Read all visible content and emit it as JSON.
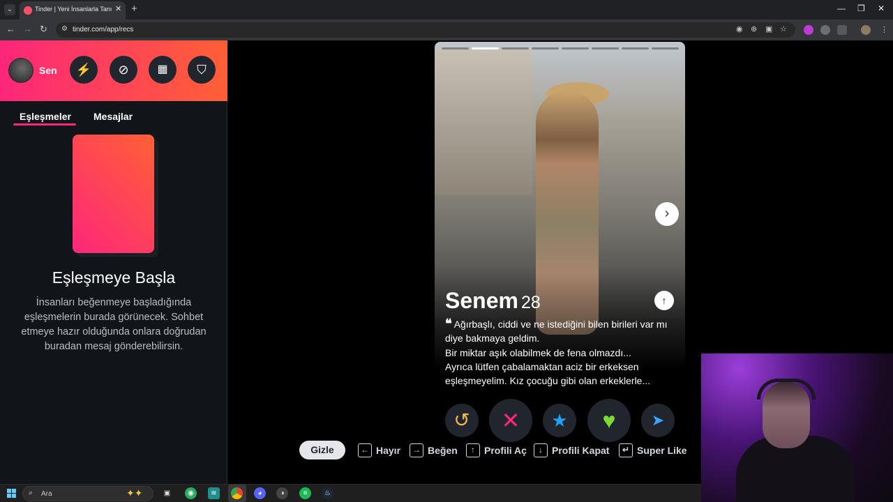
{
  "browser": {
    "tab_title": "Tinder | Yeni İnsanlarla Tanış, Bu",
    "close_glyph": "✕",
    "new_tab_glyph": "+",
    "url": "tinder.com/app/recs",
    "back": "←",
    "forward": "→",
    "reload": "↻"
  },
  "sidebar": {
    "user_name": "Sen",
    "tabs": [
      {
        "label": "Eşleşmeler"
      },
      {
        "label": "Mesajlar"
      }
    ],
    "empty_title": "Eşleşmeye Başla",
    "empty_text": "İnsanları beğenmeye başladığında eşleşmelerin burada görünecek. Sohbet etmeye hazır olduğunda onlara doğrudan buradan mesaj gönderebilirsin."
  },
  "profile": {
    "name": "Senem",
    "age": "28",
    "photo_count": 8,
    "active_photo": 2,
    "bio": [
      "Ağırbaşlı, ciddi ve ne istediğini bilen birileri var mı diye bakmaya geldim.",
      "Bir miktar aşık olabilmek de fena olmazdı...",
      "Ayrıca lütfen çabalamaktan aciz bir erkeksen eşleşmeyelim. Kız çocuğu gibi olan erkeklerle..."
    ]
  },
  "actions": {
    "rewind": "↺",
    "nope": "✕",
    "super_like": "★",
    "like": "♥",
    "boost": "➤"
  },
  "colors": {
    "brand_gradient_start": "#fd267a",
    "brand_gradient_end": "#ff6036",
    "rewind": "#f5b748",
    "nope": "#fd267a",
    "super_like": "#1da1f2",
    "like": "#7cdb33",
    "boost": "#3ca4ff"
  },
  "shortcuts": {
    "hide_label": "Gizle",
    "items": [
      {
        "key": "←",
        "label": "Hayır"
      },
      {
        "key": "→",
        "label": "Beğen"
      },
      {
        "key": "↑",
        "label": "Profili Aç"
      },
      {
        "key": "↓",
        "label": "Profili Kapat"
      },
      {
        "key": "↵",
        "label": "Super Like"
      }
    ]
  },
  "taskbar": {
    "search_placeholder": "Ara"
  }
}
